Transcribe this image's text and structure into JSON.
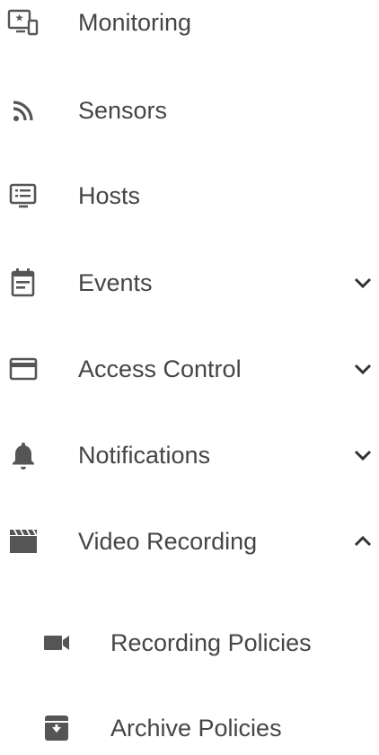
{
  "nav": {
    "items": [
      {
        "label": "Monitoring",
        "icon": "monitor-star-icon"
      },
      {
        "label": "Sensors",
        "icon": "rss-feed-icon"
      },
      {
        "label": "Hosts",
        "icon": "host-list-icon"
      },
      {
        "label": "Events",
        "icon": "calendar-events-icon",
        "expandable": true,
        "expanded": false
      },
      {
        "label": "Access Control",
        "icon": "credit-card-icon",
        "expandable": true,
        "expanded": false
      },
      {
        "label": "Notifications",
        "icon": "bell-icon",
        "expandable": true,
        "expanded": false
      },
      {
        "label": "Video Recording",
        "icon": "clapperboard-icon",
        "expandable": true,
        "expanded": true,
        "children": [
          {
            "label": "Recording Policies",
            "icon": "video-camera-icon"
          },
          {
            "label": "Archive Policies",
            "icon": "archive-icon"
          }
        ]
      }
    ]
  },
  "colors": {
    "text": "#454545",
    "icon": "#555555",
    "background": "#ffffff"
  }
}
